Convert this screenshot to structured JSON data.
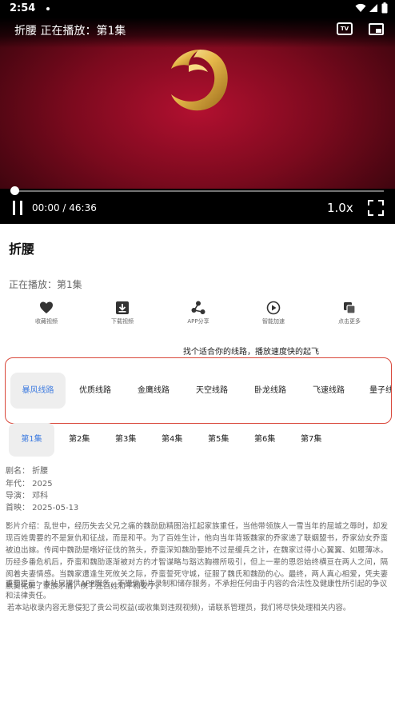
{
  "status_bar": {
    "time": "2:54"
  },
  "player": {
    "title": "折腰 正在播放：第1集",
    "current_time": "00:00",
    "duration": "46:36",
    "time_separator": " / ",
    "speed": "1.0x",
    "progress": 0,
    "tv_label": "TV"
  },
  "details": {
    "title": "折腰",
    "now_playing": "正在播放：第1集"
  },
  "actions": [
    {
      "label": "收藏视频",
      "icon": "heart-icon"
    },
    {
      "label": "下载视频",
      "icon": "download-icon"
    },
    {
      "label": "APP分享",
      "icon": "share-icon"
    },
    {
      "label": "智能加速",
      "icon": "speed-icon"
    },
    {
      "label": "点击更多",
      "icon": "more-icon"
    }
  ],
  "lines_hint": "找个适合你的线路，播放速度快的起飞",
  "lines": [
    "暴风线路",
    "优质线路",
    "金鹰线路",
    "天空线路",
    "卧龙线路",
    "飞速线路",
    "量子线路"
  ],
  "active_line": 0,
  "episodes": [
    "第1集",
    "第2集",
    "第3集",
    "第4集",
    "第5集",
    "第6集",
    "第7集"
  ],
  "active_episode": 0,
  "meta": {
    "name": "剧名：  折腰",
    "year": "年代：  2025",
    "director": "导演：  邓科",
    "premiere": "首映：  2025-05-13"
  },
  "description": "影片介绍：乱世中，经历失去父兄之痛的魏劭励精图治扛起家族重任，当他带领族人一雪当年的屈城之辱时，却发现百姓需要的不是复仇和征战，而是和平。为了百姓生计，他向当年背叛魏家的乔家递了联姻盟书，乔家幼女乔蛮被迫出嫁。传闻中魏劭是嗜好征伐的煞头，乔蛮深知魏劭娶她不过是缓兵之计，在魏家过得小心翼翼、如履薄冰。历经多番危机后，乔蛮和魏劭逐渐被对方的才智谋略与豁达胸襟所吸引，但上一辈的恩怨始终横亘在两人之间，隔阂着夫妻情感。当魏家遭逢生死攸关之际，乔蛮誓死守城，征服了魏氏和魏劭的心。最终，两人真心相爱，凭夫妻默契化解了家族矛盾，携手还百姓和平和安宁。",
  "notice": "重要提示：本站只提供APP服务，不提供影片录制和储存服务，不承担任何由于内容的合法性及健康性所引起的争议和法律责任。",
  "notice2": "若本站收录内容无意侵犯了贵公司权益(或收集到违规视频)，请联系管理员，我们将尽快处理相关内容。"
}
